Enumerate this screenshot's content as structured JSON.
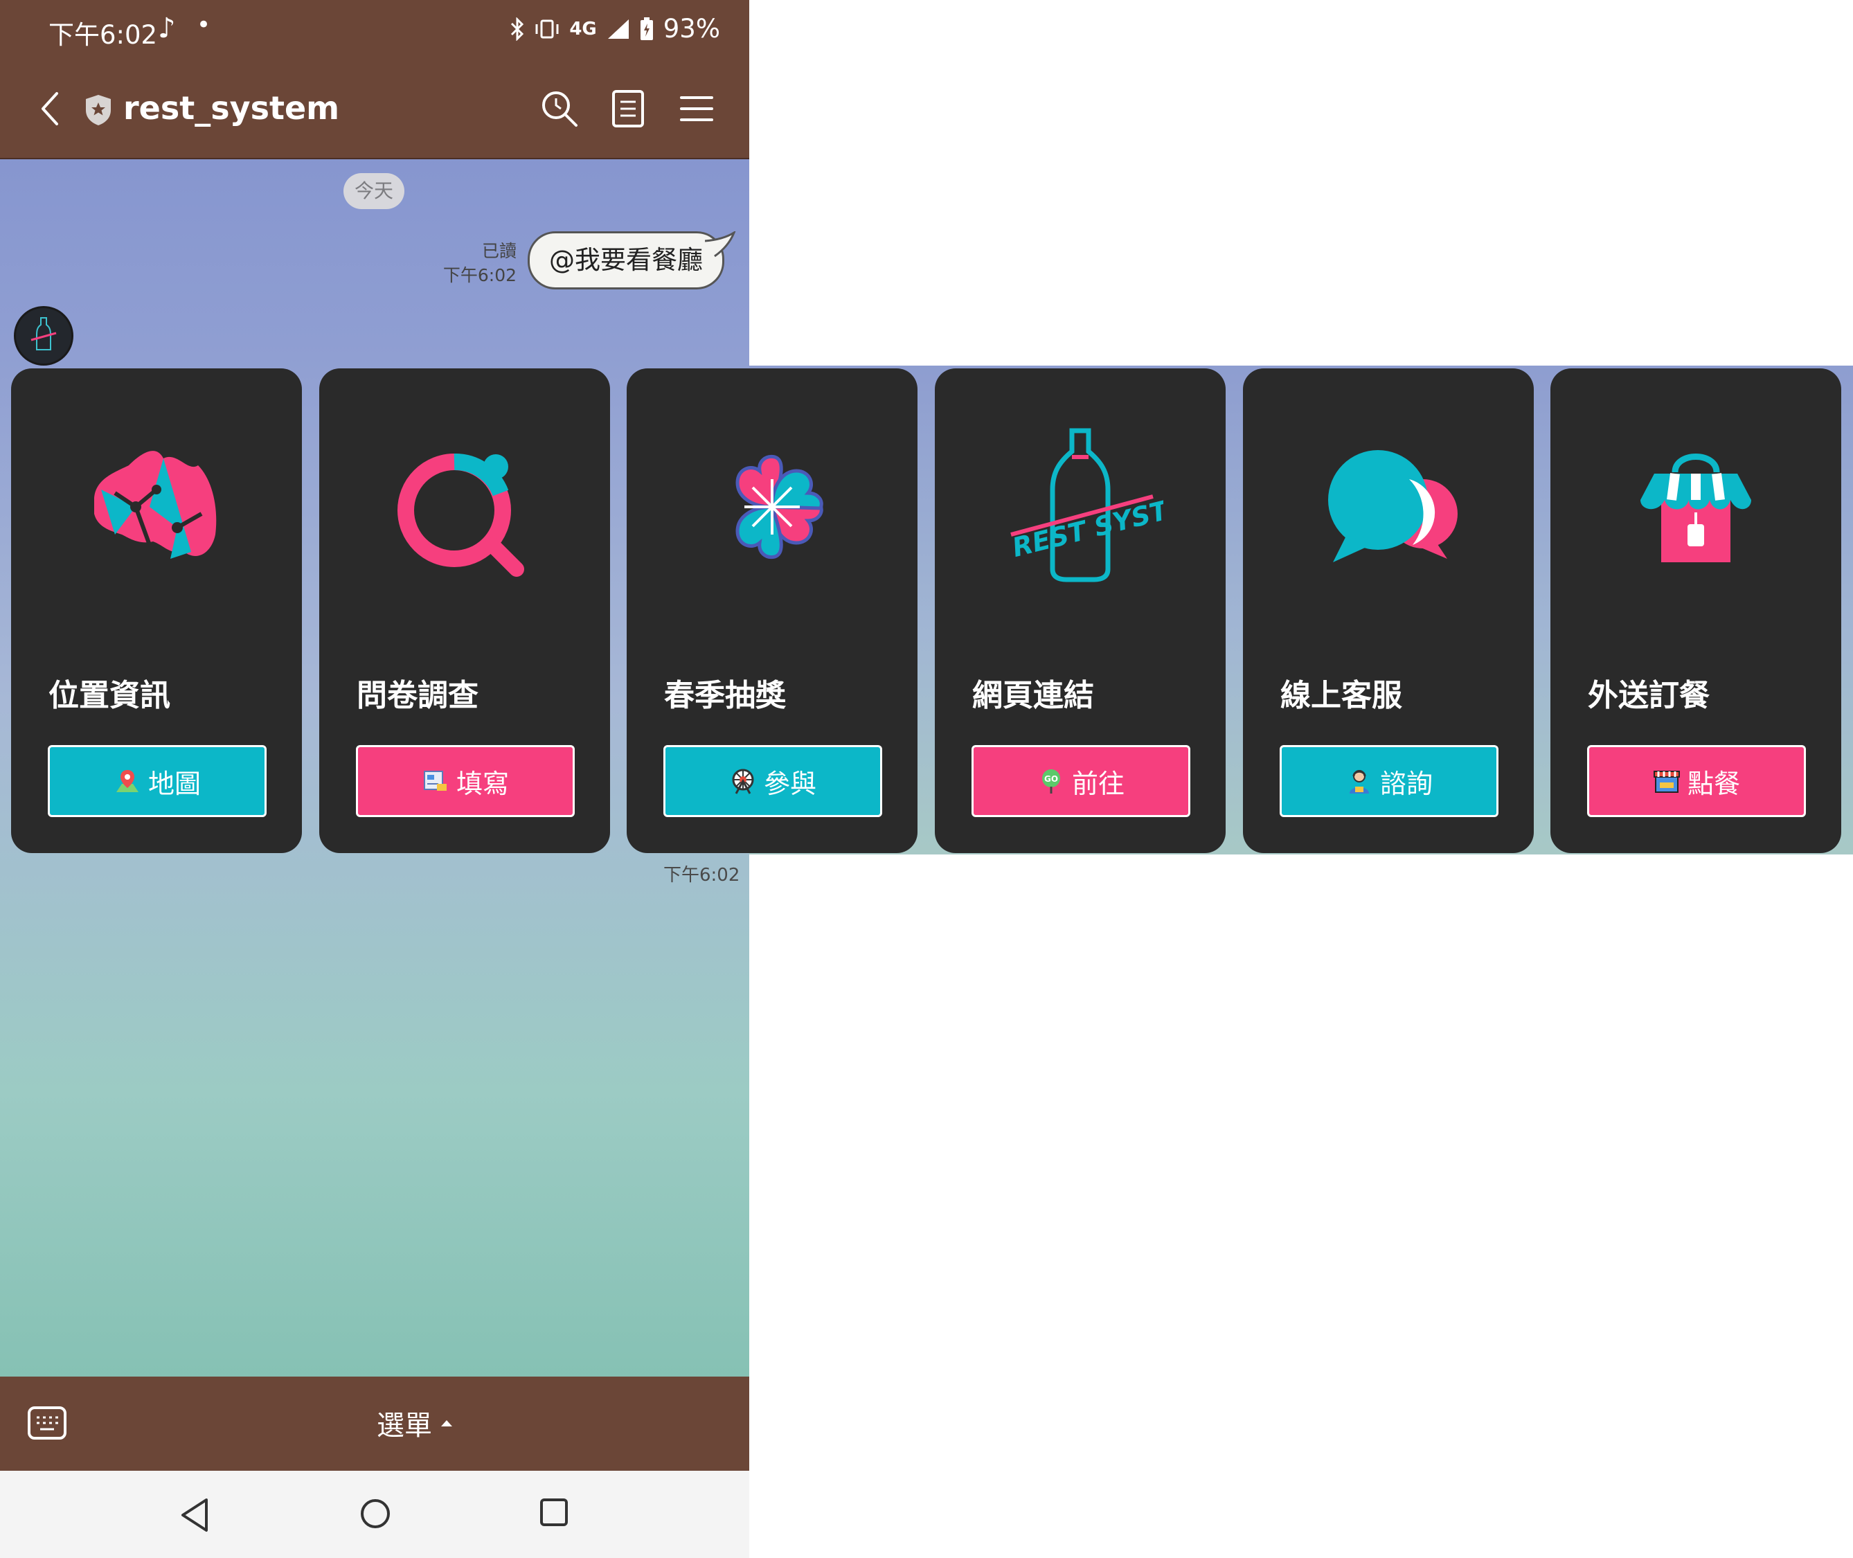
{
  "status_bar": {
    "time": "下午6:02",
    "note_icon": "music-note-icon",
    "bluetooth_icon": "bluetooth-icon",
    "vibrate_icon": "vibrate-icon",
    "network": "4G",
    "signal_icon": "signal-icon",
    "battery_icon": "battery-icon",
    "battery_percent": "93%"
  },
  "header": {
    "title": "rest_system",
    "back_icon": "chevron-left-icon",
    "verified_icon": "shield-icon",
    "search_icon": "search-icon",
    "notes_icon": "notes-icon",
    "menu_icon": "hamburger-menu-icon"
  },
  "chat": {
    "date_label": "今天",
    "user_message": {
      "text": "@我要看餐廳",
      "read_label": "已讀",
      "time": "下午6:02"
    },
    "bot_message_time": "下午6:02"
  },
  "cards": [
    {
      "title": "位置資訊",
      "button_label": "地圖",
      "button_color": "#0cb7c8",
      "icon": "map-icon",
      "button_icon": "map-pin-emoji-icon"
    },
    {
      "title": "問卷調查",
      "button_label": "填寫",
      "button_color": "#f63f7e",
      "icon": "survey-search-icon",
      "button_icon": "form-emoji-icon"
    },
    {
      "title": "春季抽獎",
      "button_label": "參與",
      "button_color": "#0cb7c8",
      "icon": "clover-icon",
      "button_icon": "ferris-wheel-emoji-icon"
    },
    {
      "title": "網頁連結",
      "button_label": "前往",
      "button_color": "#f63f7e",
      "icon": "rest-system-bottle-icon",
      "button_icon": "go-pin-emoji-icon"
    },
    {
      "title": "線上客服",
      "button_label": "諮詢",
      "button_color": "#0cb7c8",
      "icon": "chat-bubbles-icon",
      "button_icon": "agent-emoji-icon"
    },
    {
      "title": "外送訂餐",
      "button_label": "點餐",
      "button_color": "#f63f7e",
      "icon": "shop-bag-icon",
      "button_icon": "store-emoji-icon"
    }
  ],
  "bottom_bar": {
    "keyboard_icon": "keyboard-icon",
    "menu_label": "選單",
    "caret_icon": "caret-up-icon"
  },
  "nav": {
    "back_icon": "nav-back-icon",
    "home_icon": "nav-home-icon",
    "recent_icon": "nav-recent-icon"
  },
  "colors": {
    "brown": "#6b4637",
    "card": "#2a2a2a",
    "teal": "#0cb7c8",
    "pink": "#f63f7e"
  }
}
